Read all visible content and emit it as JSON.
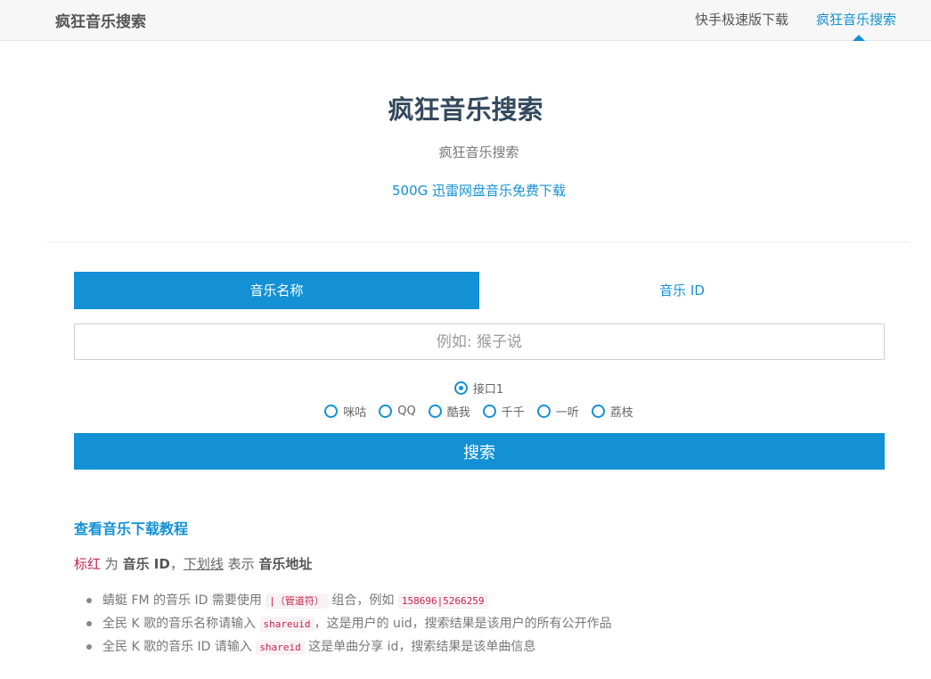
{
  "nav": {
    "brand": "疯狂音乐搜索",
    "links": [
      "快手极速版下载",
      "疯狂音乐搜索"
    ],
    "active_index": 1
  },
  "header": {
    "title": "疯狂音乐搜索",
    "subtitle": "疯狂音乐搜索",
    "promo_link": "500G 迅雷网盘音乐免费下载"
  },
  "tabs": [
    {
      "label": "音乐名称",
      "active": true
    },
    {
      "label": "音乐 ID",
      "active": false
    }
  ],
  "search": {
    "placeholder": "例如: 猴子说",
    "value": "",
    "button_label": "搜索"
  },
  "sources": {
    "row1": [
      {
        "label": "接口1",
        "checked": true
      }
    ],
    "row2": [
      {
        "label": "咪咕",
        "checked": false
      },
      {
        "label": "QQ",
        "checked": false
      },
      {
        "label": "酷我",
        "checked": false
      },
      {
        "label": "千千",
        "checked": false
      },
      {
        "label": "一听",
        "checked": false
      },
      {
        "label": "荔枝",
        "checked": false
      }
    ]
  },
  "help": {
    "title": "查看音乐下载教程",
    "legend": {
      "red_text": "标红",
      "t1": " 为 ",
      "bold1": "音乐 ID",
      "t2": "，",
      "underline_text": "下划线",
      "t3": " 表示 ",
      "bold2": "音乐地址"
    },
    "tips": [
      {
        "pre": "蜻蜓 FM 的音乐 ID 需要使用 ",
        "code": "|（管道符）",
        "mid": " 组合，例如 ",
        "code2": "158696|5266259",
        "post": ""
      },
      {
        "pre": "全民 K 歌的音乐名称请输入 ",
        "code": "shareuid",
        "mid": "，这是用户的 uid，搜索结果是该用户的所有公开作品",
        "code2": "",
        "post": ""
      },
      {
        "pre": "全民 K 歌的音乐 ID 请输入 ",
        "code": "shareid",
        "mid": " 这是单曲分享 id，搜索结果是该单曲信息",
        "code2": "",
        "post": ""
      }
    ]
  },
  "colors": {
    "accent": "#1391d4",
    "heading": "#34495e",
    "code_red": "#c7254e"
  }
}
